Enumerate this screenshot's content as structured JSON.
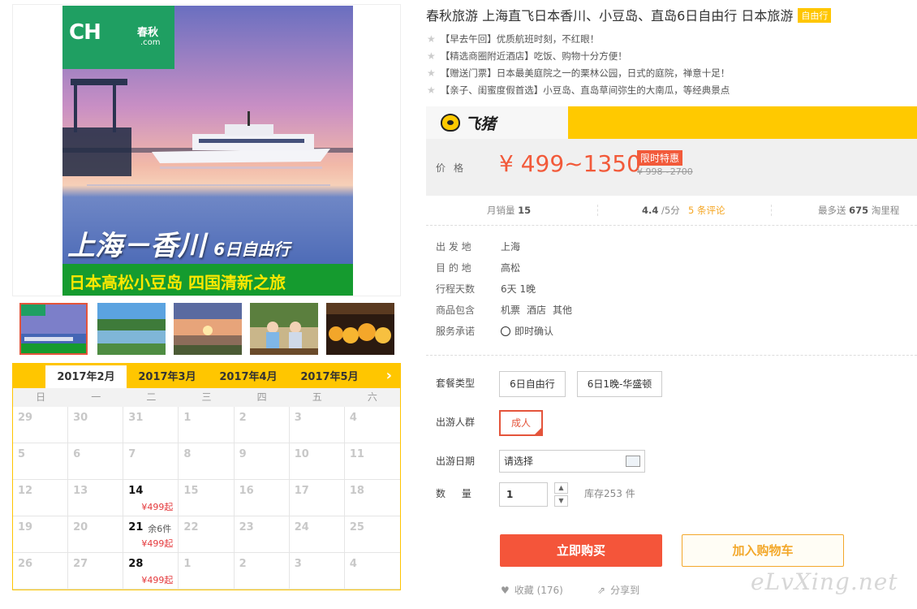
{
  "poster": {
    "logo_text": "CH",
    "logo_cn": "春秋",
    "logo_domain": ".com",
    "headline": "上海－香川",
    "headline_sub": "6日自由行",
    "tagline": "日本高松小豆岛 四国清新之旅"
  },
  "thumbnails": [
    "thumb-poster",
    "thumb-lake",
    "thumb-sunset",
    "thumb-people",
    "thumb-lanterns"
  ],
  "calendar": {
    "months": [
      "2017年2月",
      "2017年3月",
      "2017年4月",
      "2017年5月"
    ],
    "active_month": "2017年2月",
    "weekdays": [
      "日",
      "一",
      "二",
      "三",
      "四",
      "五",
      "六"
    ],
    "cells": [
      {
        "day": "29"
      },
      {
        "day": "30"
      },
      {
        "day": "31"
      },
      {
        "day": "1"
      },
      {
        "day": "2"
      },
      {
        "day": "3"
      },
      {
        "day": "4"
      },
      {
        "day": "5"
      },
      {
        "day": "6"
      },
      {
        "day": "7"
      },
      {
        "day": "8"
      },
      {
        "day": "9"
      },
      {
        "day": "10"
      },
      {
        "day": "11"
      },
      {
        "day": "12"
      },
      {
        "day": "13"
      },
      {
        "day": "14",
        "avail": true,
        "price": "¥499起"
      },
      {
        "day": "15"
      },
      {
        "day": "16"
      },
      {
        "day": "17"
      },
      {
        "day": "18"
      },
      {
        "day": "19"
      },
      {
        "day": "20"
      },
      {
        "day": "21",
        "avail": true,
        "stock": "余6件",
        "price": "¥499起"
      },
      {
        "day": "22"
      },
      {
        "day": "23"
      },
      {
        "day": "24"
      },
      {
        "day": "25"
      },
      {
        "day": "26"
      },
      {
        "day": "27"
      },
      {
        "day": "28",
        "avail": true,
        "price": "¥499起"
      },
      {
        "day": "1"
      },
      {
        "day": "2"
      },
      {
        "day": "3"
      },
      {
        "day": "4"
      }
    ]
  },
  "product": {
    "title": "春秋旅游 上海直飞日本香川、小豆岛、直岛6日自由行 日本旅游",
    "badge": "自由行",
    "features": [
      "【早去午回】优质航班时刻，不红眼！",
      "【精选商圈附近酒店】吃饭、购物十分方便！",
      "【赠送门票】日本最美庭院之一的栗林公园，日式的庭院，禅意十足！",
      "【亲子、闺蜜度假首选】小豆岛、直岛草间弥生的大南瓜，等经典景点"
    ]
  },
  "brand": {
    "name": "飞猪"
  },
  "price": {
    "label": "价格",
    "range": "¥ 499~1350",
    "promo": "限时特惠",
    "original": "¥ 998~2700"
  },
  "stats": {
    "sales_label": "月销量",
    "sales_value": "15",
    "rating": "4.4",
    "rating_suffix": "/5分",
    "reviews": "5 条评论",
    "points_prefix": "最多送",
    "points_value": "675",
    "points_suffix": "淘里程"
  },
  "info": [
    {
      "key": "出 发 地",
      "value": "上海"
    },
    {
      "key": "目 的 地",
      "value": "高松"
    },
    {
      "key": "行程天数",
      "value": "6天 1晚"
    },
    {
      "key": "商品包含",
      "values": [
        "机票",
        "酒店",
        "其他"
      ]
    },
    {
      "key": "服务承诺",
      "value": "即时确认"
    }
  ],
  "options": {
    "package_label": "套餐类型",
    "packages": [
      "6日自由行",
      "6日1晚-华盛顿"
    ],
    "group_label": "出游人群",
    "group": "成人",
    "date_label": "出游日期",
    "date_placeholder": "请选择",
    "qty_label": "数 量",
    "qty_value": "1",
    "stock": "库存253 件"
  },
  "actions": {
    "buy": "立即购买",
    "cart": "加入购物车",
    "favorite": "收藏 (176)",
    "share": "分享到"
  },
  "watermark": "eLvXing.net",
  "colors": {
    "accent": "#f4553a",
    "brand_yellow": "#ffc600",
    "cart": "#f3a82b"
  }
}
